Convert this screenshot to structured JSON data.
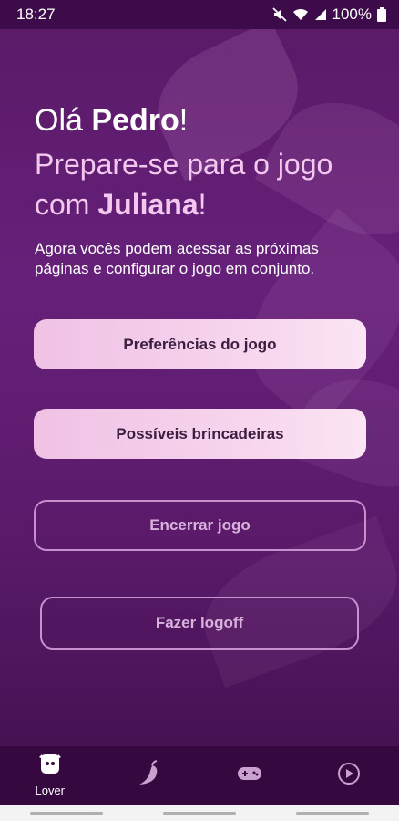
{
  "status_bar": {
    "time": "18:27",
    "battery": "100%",
    "icons": [
      "mute-icon",
      "wifi-icon",
      "signal-icon",
      "battery-icon"
    ]
  },
  "header": {
    "greeting_prefix": "Olá ",
    "user_name": "Pedro",
    "greeting_suffix": "!",
    "line2_prefix": "Prepare-se para o jogo com ",
    "partner_name": "Juliana",
    "line2_suffix": "!",
    "description": "Agora vocês podem acessar as próximas páginas e configurar o jogo em conjunto."
  },
  "buttons": {
    "preferences": "Preferências do jogo",
    "activities": "Possíveis brincadeiras",
    "end_game": "Encerrar jogo",
    "logoff": "Fazer logoff"
  },
  "bottom_nav": {
    "items": [
      {
        "label": "Lover",
        "icon": "lover-face-icon"
      },
      {
        "label": "",
        "icon": "pepper-icon"
      },
      {
        "label": "",
        "icon": "gamepad-icon"
      },
      {
        "label": "",
        "icon": "play-circle-icon"
      }
    ]
  },
  "colors": {
    "background": "#5a1a66",
    "button_fill": "#f0c1e4",
    "outline": "#c890d0",
    "headline_accent": "#f3c8ef",
    "nav_bg": "#35083f"
  }
}
